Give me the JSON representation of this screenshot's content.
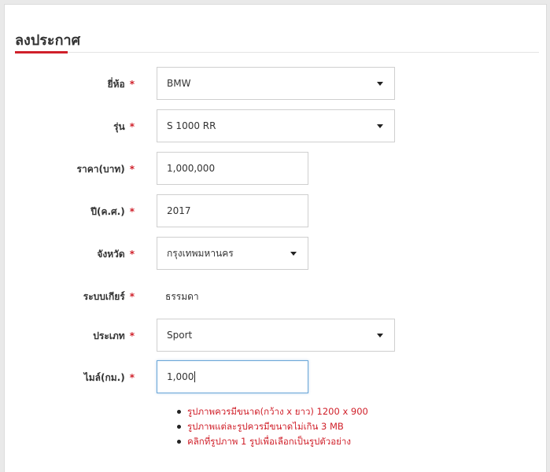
{
  "page": {
    "title": "ลงประกาศ",
    "accent_color": "#d0202a"
  },
  "form": {
    "required_mark": "*",
    "fields": [
      {
        "label": "ยี่ห้อ",
        "type": "select",
        "value": "BMW"
      },
      {
        "label": "รุ่น",
        "type": "select",
        "value": "S 1000 RR"
      },
      {
        "label": "ราคา(บาท)",
        "type": "text",
        "value": "1,000,000"
      },
      {
        "label": "ปี(ค.ศ.)",
        "type": "text",
        "value": "2017"
      },
      {
        "label": "จังหวัด",
        "type": "select",
        "value": "กรุงเทพมหานคร"
      },
      {
        "label": "ระบบเกียร์",
        "type": "static",
        "value": "ธรรมดา"
      },
      {
        "label": "ประเภท",
        "type": "select",
        "value": "Sport"
      },
      {
        "label": "ไมล์(กม.)",
        "type": "text",
        "value": "1,000",
        "focused": true
      }
    ]
  },
  "notes": [
    "รูปภาพควรมีขนาด(กว้าง x ยาว) 1200 x 900",
    "รูปภาพแต่ละรูปควรมีขนาดไม่เกิน 3 MB",
    "คลิกที่รูปภาพ 1 รูปเพื่อเลือกเป็นรูปตัวอย่าง"
  ]
}
